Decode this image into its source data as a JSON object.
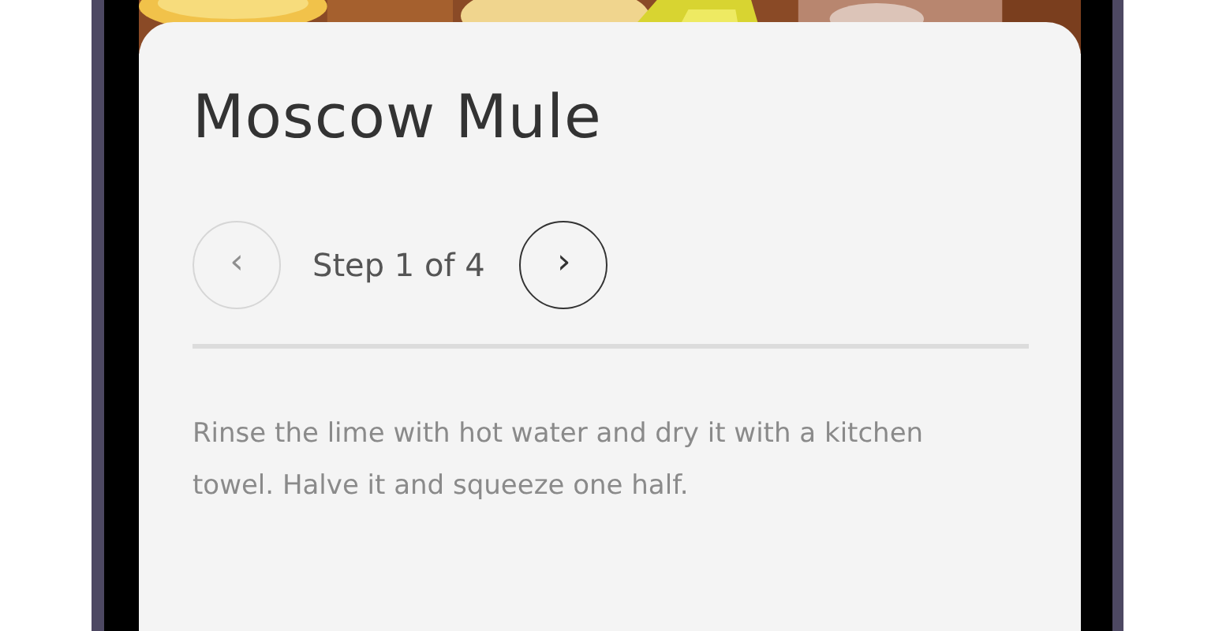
{
  "recipe": {
    "title": "Moscow Mule"
  },
  "stepper": {
    "prev": {
      "label": "‹",
      "disabled": true
    },
    "step": "Step 1 of 4",
    "next": {
      "label": "›",
      "disabled": false
    }
  },
  "instruction": "Rinse the lime with hot water and dry it with a kitchen towel. Halve it and squeeze one half."
}
